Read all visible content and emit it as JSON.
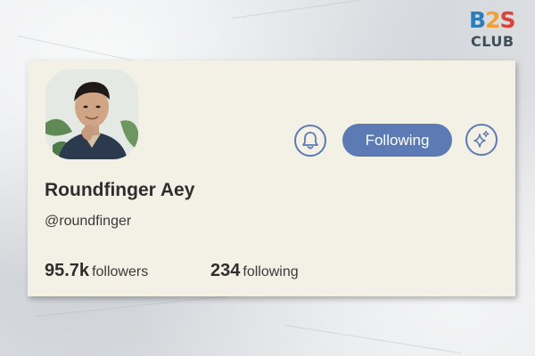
{
  "brand": {
    "part1": "B",
    "part2": "2",
    "part3": "S",
    "line2": "CLUB"
  },
  "profile": {
    "display_name": "Roundfinger Aey",
    "handle": "@roundfinger",
    "followers_count": "95.7k",
    "followers_label": "followers",
    "following_count": "234",
    "following_label": "following"
  },
  "actions": {
    "notify_icon": "bell-icon",
    "follow_label": "Following",
    "extra_icon": "sparkle-icon"
  },
  "colors": {
    "accent": "#5c7bb4",
    "card_background": "#f3f0e6",
    "text": "#2e2e2e"
  }
}
